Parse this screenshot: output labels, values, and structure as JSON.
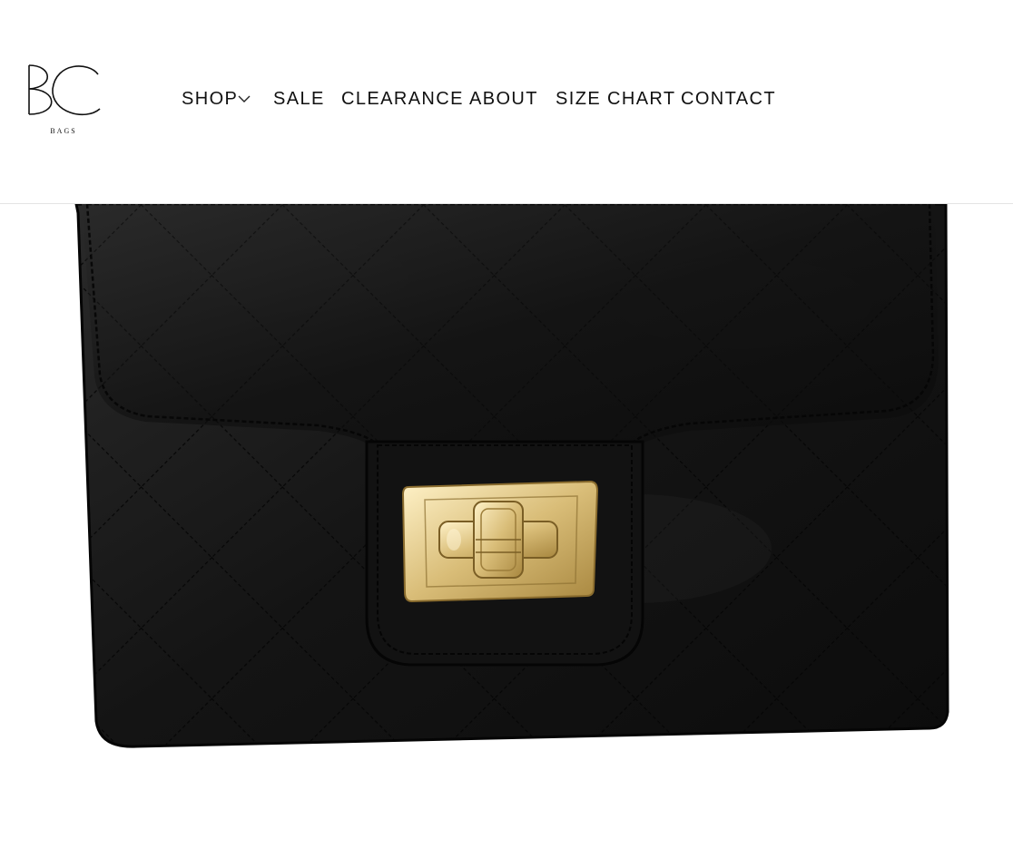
{
  "brand": {
    "logo_text": "BAGS",
    "logo_icon": "bc-monogram-logo"
  },
  "nav": {
    "items": [
      {
        "label": "SHOP",
        "has_dropdown": true,
        "dropdown_icon": "chevron-down-icon"
      },
      {
        "label": "SALE"
      },
      {
        "label": "CLEARANCE"
      },
      {
        "label": "ABOUT"
      },
      {
        "label": "SIZE CHART"
      },
      {
        "label": "CONTACT"
      }
    ]
  },
  "product_image": {
    "subject": "black quilted wallet with gold turn-lock clasp",
    "colors": {
      "leather": "#141414",
      "stitch": "#050505",
      "clasp": "#e0c884"
    }
  }
}
